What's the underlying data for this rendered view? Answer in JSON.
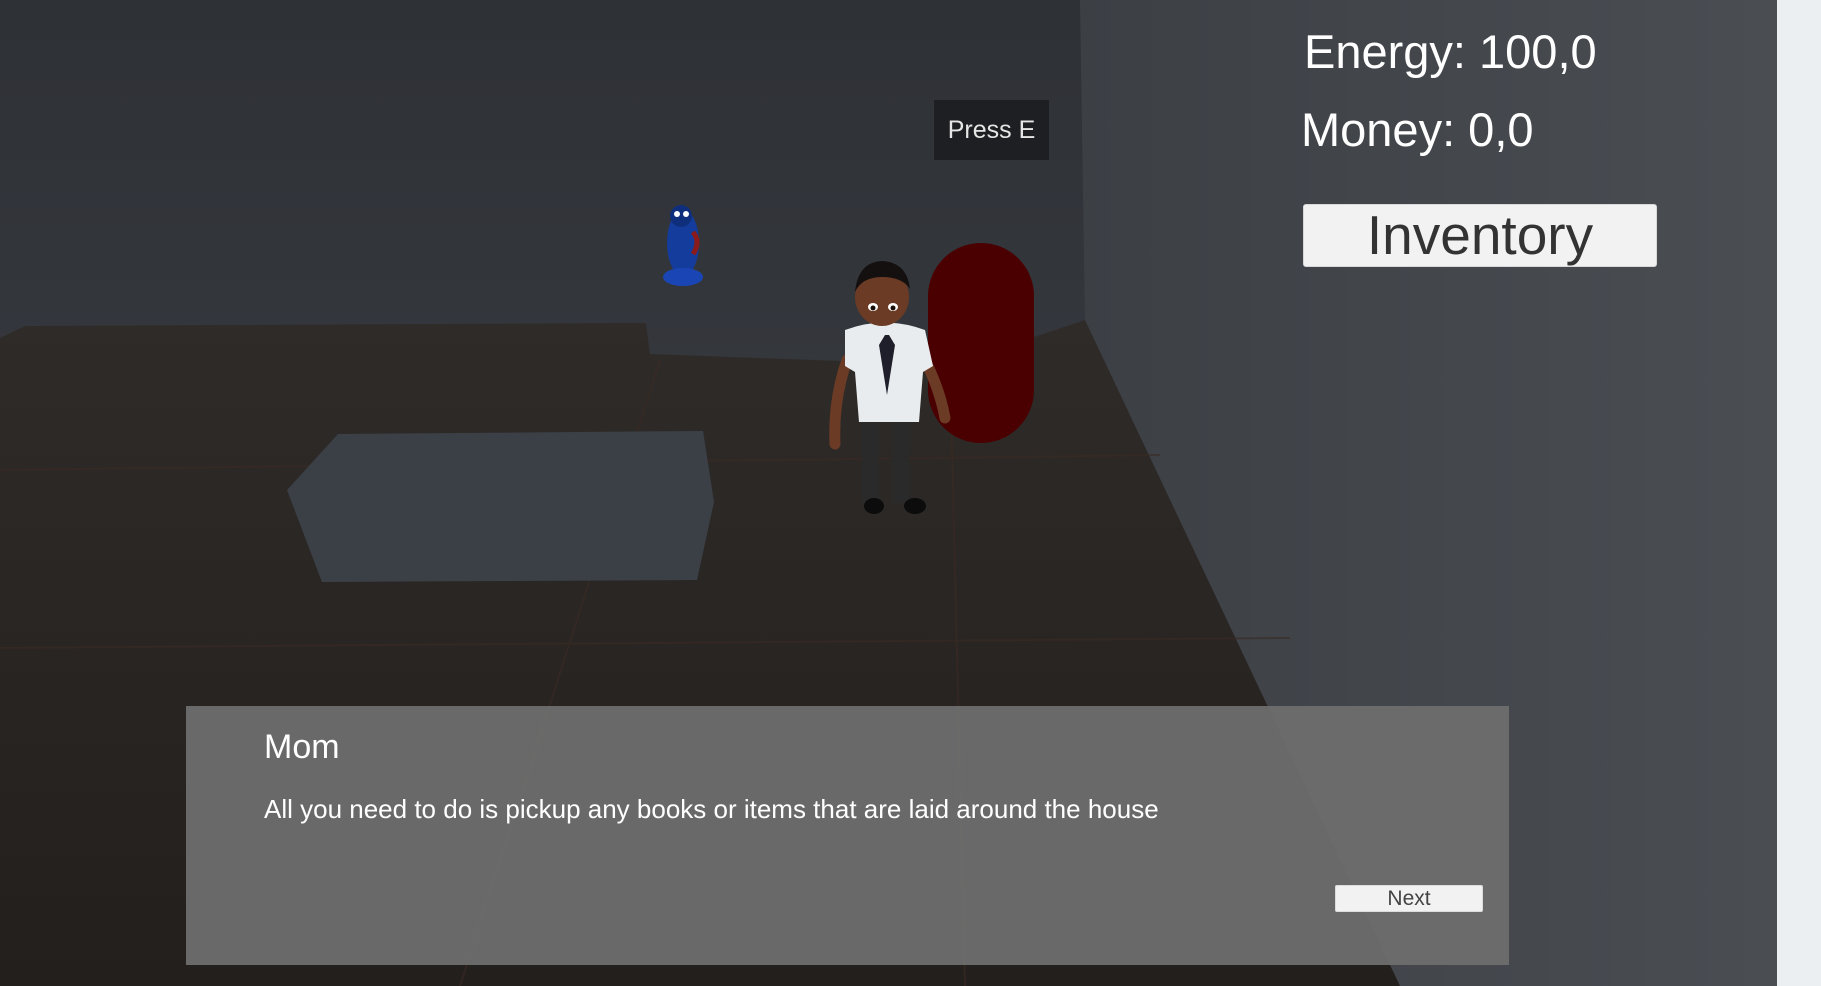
{
  "hud": {
    "energy": "Energy: 100,0",
    "money": "Money: 0,0",
    "inventory_label": "Inventory"
  },
  "prompt": {
    "text": "Press E"
  },
  "dialog": {
    "speaker": "Mom",
    "text": "All you need to do is pickup any books or items that are laid around the house",
    "next_label": "Next"
  },
  "colors": {
    "wall": "#3a3d42",
    "floor": "#2a2624",
    "rug": "#3b4047",
    "capsule": "#4a0000",
    "dialog_bg": "#6e6e6e"
  }
}
